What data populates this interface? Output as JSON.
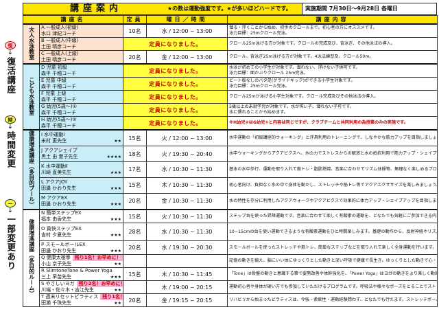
{
  "header": {
    "title": "講座案内",
    "note": "★の数は運動強度です。★が多いほどハードです。",
    "period": "実施期間 7月30日～9月28日 各曜日"
  },
  "side": {
    "badge1": "復",
    "text1": "復活講座",
    "badge2": "時",
    "text2": "時間変更",
    "badge3": "一",
    "text3": "一部変更あり",
    "arrow": "↓"
  },
  "columns": {
    "name": "講座名",
    "cap": "定員",
    "time": "曜日／時間",
    "content": "講座内容"
  },
  "groups": {
    "adult": "大人水泳教室",
    "kids": "こども水泳教室",
    "pool": "健康増進講座（多目的プール）",
    "room": "健康増進講座（多目的ルーム）"
  },
  "rows": [
    {
      "code": "A 一般成人(初級)",
      "teacher": "水口 津紀コーチ",
      "stars": "",
      "cap": "10名",
      "time": "水 / 12:00 ~ 13:00",
      "content": [
        "潜る・浮くことから始め、初歩のクロールまで。初心者の方にオススメです。",
        "泳力目標：25mクロール完泳。"
      ]
    },
    {
      "code": "B 一般成人(中級)",
      "teacher": "土田 晴彦コーチ",
      "stars": "",
      "full": "定員になりました。",
      "content": [
        "クロール25m泳げる方が対象です。クロールの完成及び、背泳ぎ、その他泳法の導入。"
      ]
    },
    {
      "code": "C 一般成人(上級)",
      "teacher": "土田 晴彦コーチ",
      "stars": "",
      "cap": "20名",
      "time": "金 / 12:00 ~ 13:00",
      "content": [
        "クロール、背泳ぎ25m泳げる方が対象です。4泳法練習及、クロール50m。"
      ]
    },
    {
      "code": "D 児童 初級",
      "teacher": "森平 千穂コーチ",
      "stars": "",
      "full": "定員になりました。",
      "content": [
        "水泳が初めての小学生が対象です。潜れない、浮けない子供可です。",
        "泳力目標：面かぶりクロール 25m完泳。"
      ]
    },
    {
      "code": "E 児童 中級",
      "teacher": "森平 千穂コーチ",
      "stars": "",
      "full": "定員になりました。",
      "content": [
        "ビート板なしのバタ足(グライドキック)ができる小学生対象です。",
        "泳力目標：25mクロール完泳。"
      ]
    },
    {
      "code": "F 児童 上級",
      "teacher": "森平 千穂コーチ",
      "stars": "",
      "full": "定員になりました。",
      "content": [
        "クロール25mが泳げる小学生対象です。クロール完成及びその他泳法の導入。"
      ]
    },
    {
      "code": "G 幼児(5歳～)①",
      "teacher": "森平 千穂コーチ",
      "stars": "",
      "full": "定員になりました。",
      "content": [
        "5歳以上の未就学児が対象です。水が怖い子、潜れない子可です。",
        "水に慣れることから始めます。"
      ]
    },
    {
      "code": "H 幼児(5歳～)②",
      "teacher": "森平 千穂コーチ",
      "stars": "",
      "full": "定員になりました。",
      "content": [
        "※H幼児②はG幼児①と内容は同じですが、クラブチームと共同利用の為授業のみの実施です。"
      ],
      "warn": true
    },
    {
      "code": "I 水中運動Ⅰ",
      "teacher": "米村 恵先生",
      "stars": "★★",
      "cap": "15名",
      "time": "火 / 12:00 ~ 13:00",
      "content": [
        "水中運動の「初級講座的ウォーキング」と浮具利用のトレーニングで、しなやかな筋力アップを目指しましょう。シルバーエイジの方もお気軽にご参加いただけます。"
      ]
    },
    {
      "code": "J アクアシェイプ",
      "teacher": "黒土 由 愛子先生",
      "stars": "★★★★",
      "cap": "18名",
      "time": "火 / 19:30 ~ 20:40",
      "content": [
        "水中ウォーキングからアクアビクスへ、水の力でストレスからの解放と水の抵抗利用で筋力アップ・シェイプアップ効果を目指します。"
      ]
    },
    {
      "code": "K 水中運動Ⅱ",
      "teacher": "川崎 直美先生",
      "stars": "★★★",
      "cap": "17名",
      "time": "水 / 10:30 ~ 11:30",
      "content": [
        "基本の水中歩行、運動を取り入れて筋トレ・脂肪燃焼、音楽に合わせてリズム体操等、無理なく楽しめるプログラムです。"
      ]
    },
    {
      "code": "L アクアJOY",
      "teacher": "田邊 かおり先生",
      "stars": "★★★",
      "cap": "15名",
      "time": "木 / 10:30 ~ 11:30",
      "content": [
        "初心者向け、負担なく水の中で身体を動かし、ストレッチや筋トレ等でアクアエクササイズを楽しみましょう。"
      ]
    },
    {
      "code": "M アクアEX",
      "teacher": "田邊 かおり先生",
      "stars": "★★★",
      "cap": "20名",
      "time": "金 / 10:30 ~ 11:30",
      "content": [
        "水の特性を存分に利用したアクアウォークやアクアビクスで効果的に体力アップ・シェイプアップを目指しましょう。"
      ]
    },
    {
      "code": "N 簡単ステップEX",
      "teacher": "福本 由香先生",
      "stars": "★★★",
      "cap": "15名",
      "time": "火 / 10:30 ~ 11:30",
      "content": [
        "ステップ台を使った昇降運動です。音楽に合わせて楽しく有酸素の運動を、どなたでも気軽にご参加できる内容となっています。ご一緒にシェイプアップを頑張ってみましょう。"
      ]
    },
    {
      "code": "O 貴快ステップEX",
      "teacher": "吉村 夕夏先生",
      "stars": "★★★",
      "cap": "28名",
      "time": "水 / 10:30 ~ 11:30",
      "content": [
        "10~15cmの台を使い運動できるような有酸素運動をひと時間楽しみます。基礎の動作から、反射神経やリズム感など様々な楽しみを取り入れた内容でお客様の状況に合わせた運動を行います。"
      ]
    },
    {
      "code": "P スモールボールEX",
      "teacher": "田邊 かおり先生",
      "stars": "★★★",
      "cap": "20名",
      "time": "水 / 19:30 ~ 20:30",
      "content": [
        "スモールボールを使ったストレッチや筋トレ、簡単なステップなどを取り入れて楽しく全身運動を行います。シェイプアップ効果抜群です。男性も参加しやすい講座です。"
      ]
    },
    {
      "code": "Q 健康太極拳",
      "teacher": "小山 京子先生",
      "stars": "★★",
      "remain": "残り1名！お早めに！",
      "cap": "",
      "time": "",
      "content": [
        "記憶の動きを鍛え、脳にいい体にゆっくりとした動きと深い呼吸で健康で長生き。ゆっくりとした動きで心・体・脳の調和・全身運動を行う健康法です。どなたでも参加いただけます。"
      ]
    },
    {
      "code": "R SlimtoneTone & Power Yoga",
      "teacher": "三上 早苗先生",
      "stars": "★★★",
      "cap": "15名",
      "time": "木 / 10:30 ~ 11:45",
      "content": [
        "「Tone」は骨盤の動きと意識する事で姿勢改善や体幹強化を、「Power Yoga」はヨガの動きをより楽しく動的に取り入れ、筋力アップと柔軟性を目指します。"
      ]
    },
    {
      "code": "S やさしいヨガ",
      "teacher": "川端・佐々木・吉江先生",
      "stars": "★★",
      "remain": "残り2名！お早めに！",
      "cap": "",
      "time": "木 / 19:00 ~ 20:15",
      "content": [
        "運動初心者や身体が硬い方でも参加していただけるプログラムです。呼吸法や様々なポーズをとることでストレス解消、筋力の養成、集中力、自律神経の安定を目指します。"
      ]
    },
    {
      "code": "T 週末リセットピラティス",
      "teacher": "田瀬 千珠先生",
      "stars": "★★",
      "remain": "残り1名！お早めに！",
      "cap": "20名",
      "time": "金 / 19:15 ~ 20:15",
      "content": [
        "リハビリから始まったピラティスは、今強・柔軟性・運動経験問わず、どなたでも行えます。ストレッチポールでコリや歪みを無理なくゆるめ、バランスを整えながら効率よく動ける身体を目指しましょう。"
      ]
    }
  ],
  "colors": {
    "yellow": "#ffe400",
    "pink": "#fde2d0",
    "blue": "#c9eef8",
    "red": "#cc0000"
  }
}
